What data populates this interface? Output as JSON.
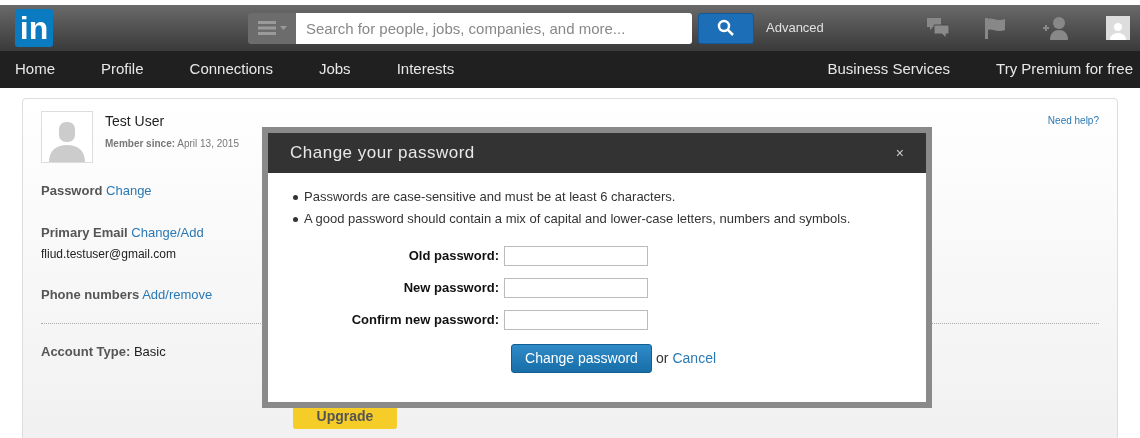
{
  "header": {
    "logo": "in",
    "search": {
      "placeholder": "Search for people, jobs, companies, and more..."
    },
    "advanced": "Advanced"
  },
  "nav": {
    "left": [
      "Home",
      "Profile",
      "Connections",
      "Jobs",
      "Interests"
    ],
    "right": [
      "Business Services",
      "Try Premium for free"
    ]
  },
  "profile": {
    "name": "Test User",
    "member_since_label": "Member since:",
    "member_since": "April 13, 2015",
    "need_help": "Need help?",
    "password": {
      "label": "Password",
      "link": "Change"
    },
    "email": {
      "label": "Primary Email",
      "link": "Change/Add",
      "value": "fliud.testuser@gmail.com"
    },
    "phone": {
      "label": "Phone numbers",
      "link": "Add/remove"
    },
    "account_type": {
      "label": "Account Type:",
      "value": "Basic"
    },
    "upgrade": "Upgrade"
  },
  "dialog": {
    "title": "Change your password",
    "close": "×",
    "notes": [
      "Passwords are case-sensitive and must be at least 6 characters.",
      "A good password should contain a mix of capital and lower-case letters, numbers and symbols."
    ],
    "fields": [
      {
        "label": "Old password:"
      },
      {
        "label": "New password:"
      },
      {
        "label": "Confirm new password:"
      }
    ],
    "submit": "Change password",
    "or": "or",
    "cancel": "Cancel"
  }
}
